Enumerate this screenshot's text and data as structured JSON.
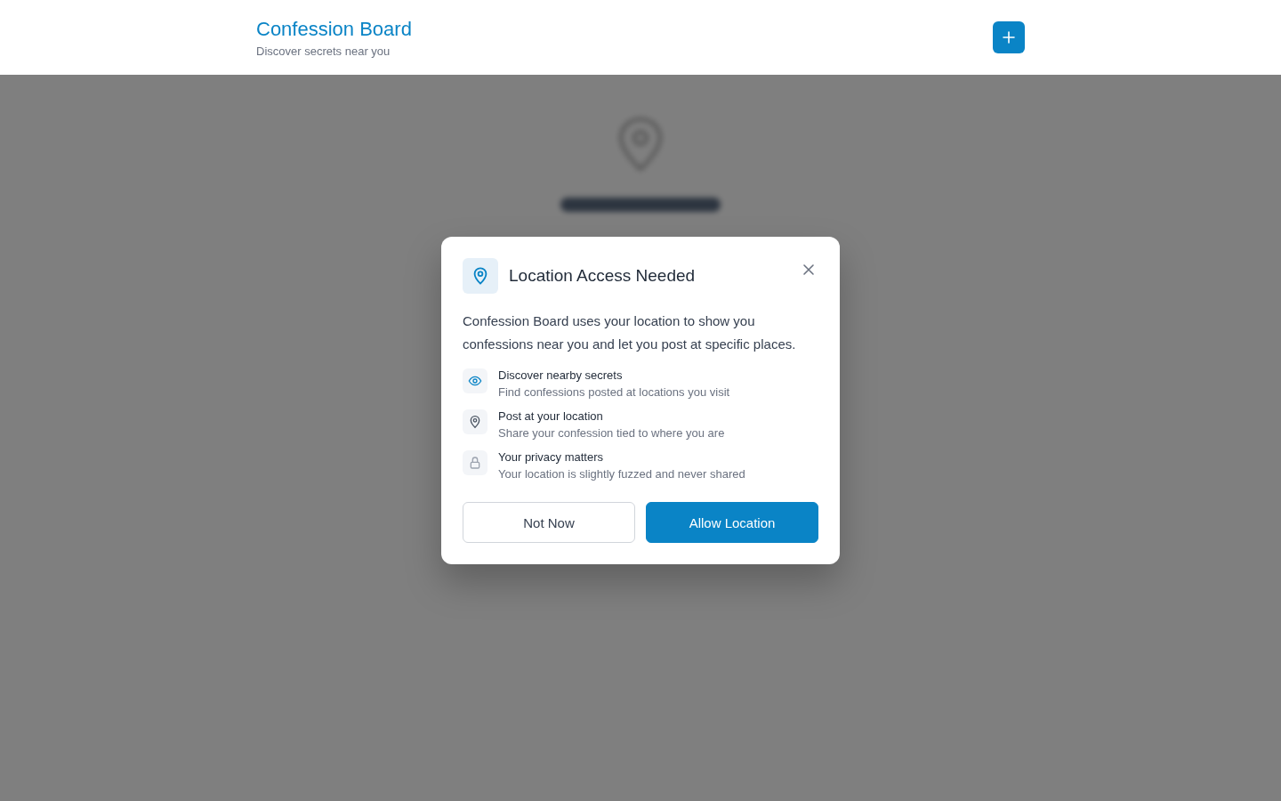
{
  "header": {
    "title": "Confession Board",
    "subtitle": "Discover secrets near you"
  },
  "dialog": {
    "title": "Location Access Needed",
    "message": "Confession Board uses your location to show you confessions near you and let you post at specific places.",
    "features": [
      {
        "kind": "eye",
        "title": "Discover nearby secrets",
        "text": "Find confessions posted at locations you visit"
      },
      {
        "kind": "pin",
        "title": "Post at your location",
        "text": "Share your confession tied to where you are"
      },
      {
        "kind": "lock",
        "title": "Your privacy matters",
        "text": "Your location is slightly fuzzed and never shared"
      }
    ],
    "buttons": [
      {
        "kind": "secondary",
        "label": "Not Now"
      },
      {
        "kind": "primary",
        "label": "Allow Location"
      }
    ]
  }
}
